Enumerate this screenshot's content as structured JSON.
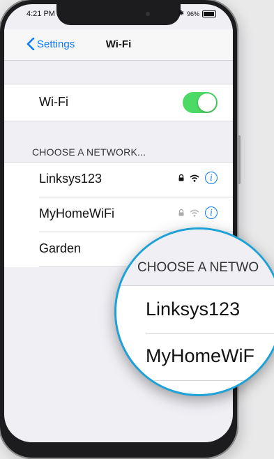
{
  "status_bar": {
    "time": "4:21 PM",
    "battery": "96%"
  },
  "nav": {
    "back_label": "Settings",
    "title": "Wi-Fi"
  },
  "wifi_toggle": {
    "label": "Wi-Fi",
    "state": "on",
    "color": "#4cd964"
  },
  "networks": {
    "header": "CHOOSE A NETWORK...",
    "items": [
      {
        "name": "Linksys123",
        "locked": true,
        "signal": "strong"
      },
      {
        "name": "MyHomeWiFi",
        "locked": true,
        "signal": "weak"
      },
      {
        "name": "Garden",
        "locked": false,
        "signal": "none"
      }
    ]
  },
  "magnifier": {
    "header": "CHOOSE A NETWO",
    "items": [
      "Linksys123",
      "MyHomeWiF"
    ]
  },
  "colors": {
    "accent": "#0a7aff",
    "toggle_on": "#4cd964",
    "magnifier_ring": "#1da1d6"
  },
  "icons": [
    "chevron-left-icon",
    "bluetooth-icon",
    "battery-icon",
    "lock-icon",
    "wifi-icon",
    "info-icon"
  ]
}
